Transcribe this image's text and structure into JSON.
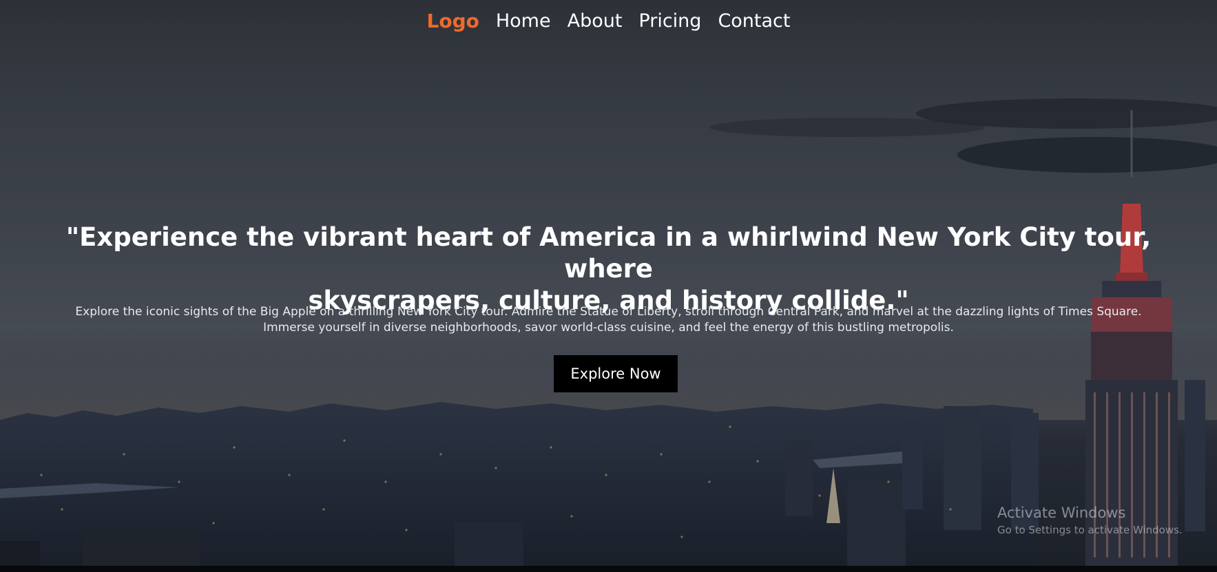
{
  "nav": {
    "logo": "Logo",
    "links": [
      "Home",
      "About",
      "Pricing",
      "Contact"
    ]
  },
  "hero": {
    "headline_line1": "\"Experience the vibrant heart of America in a whirlwind New York City tour, where",
    "headline_line2": "skyscrapers, culture, and history collide.\"",
    "subtext_line1": "Explore the iconic sights of the Big Apple on a thrilling New York City tour. Admire the Statue of Liberty, stroll through Central Park, and marvel at the dazzling lights of Times Square.",
    "subtext_line2": "Immerse yourself in diverse neighborhoods, savor world-class cuisine, and feel the energy of this bustling metropolis.",
    "cta_label": "Explore Now"
  },
  "os_watermark": {
    "title": "Activate Windows",
    "subtitle": "Go to Settings to activate Windows."
  },
  "colors": {
    "logo": "#ee6a2c",
    "button_bg": "#000000",
    "text": "#ffffff"
  }
}
